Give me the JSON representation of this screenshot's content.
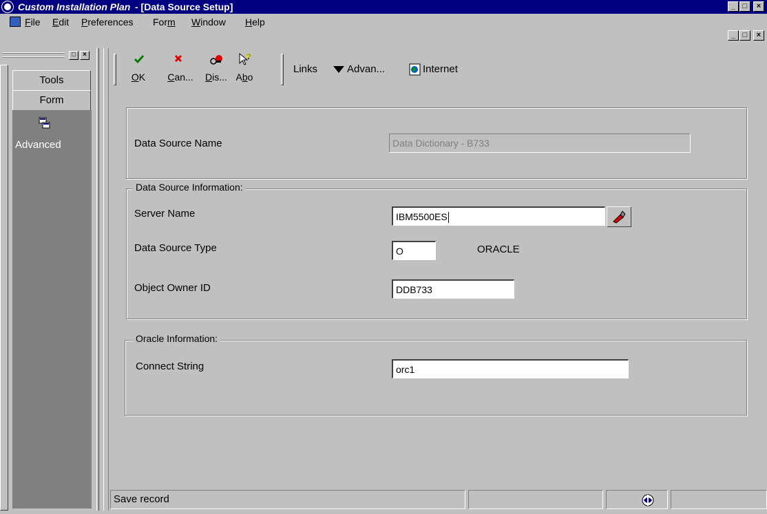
{
  "window": {
    "app_title": "Custom Installation Plan",
    "doc_title": "- [Data Source Setup]",
    "controls": [
      "_",
      "□",
      "×"
    ]
  },
  "menu": {
    "items": [
      {
        "label": "File",
        "u": "F",
        "rest": "ile"
      },
      {
        "label": "Edit",
        "u": "E",
        "rest": "dit"
      },
      {
        "label": "Preferences",
        "u": "P",
        "rest": "references"
      },
      {
        "label": "Form",
        "pre": "For",
        "u": "m",
        "rest": ""
      },
      {
        "label": "Window",
        "u": "W",
        "rest": "indow"
      },
      {
        "label": "Help",
        "u": "H",
        "rest": "elp"
      }
    ],
    "doc_controls": [
      "_",
      "□",
      "×"
    ]
  },
  "sidebar": {
    "tools_label": "Tools",
    "form_label": "Form",
    "advanced_label": "Advanced"
  },
  "toolbar": {
    "ok": {
      "u": "O",
      "rest": "K",
      "icon": "checkmark-icon"
    },
    "cancel": {
      "u": "C",
      "rest": "an...",
      "icon": "x-icon"
    },
    "display": {
      "u": "D",
      "rest": "is...",
      "icon": "display-icon"
    },
    "about": {
      "pre": "A",
      "u": "b",
      "rest": "o",
      "icon": "about-icon"
    },
    "links": "Links",
    "advanced": "Advan...",
    "internet": "Internet"
  },
  "form": {
    "data_source_name": {
      "label": "Data Source Name",
      "value": "Data Dictionary - B733"
    },
    "info_group": "Data Source Information:",
    "server_name": {
      "label": "Server Name",
      "value": "IBM5500ES"
    },
    "data_source_type": {
      "label": "Data Source Type",
      "value": "O",
      "description": "ORACLE"
    },
    "object_owner": {
      "label": "Object Owner ID",
      "value": "DDB733"
    },
    "oracle_group": "Oracle Information:",
    "connect_string": {
      "label": "Connect String",
      "value": "orc1"
    }
  },
  "status": {
    "message": "Save record"
  },
  "colors": {
    "title_bg": "#000080",
    "face": "#c0c0c0",
    "panel": "#808080",
    "field": "#ffffff"
  }
}
